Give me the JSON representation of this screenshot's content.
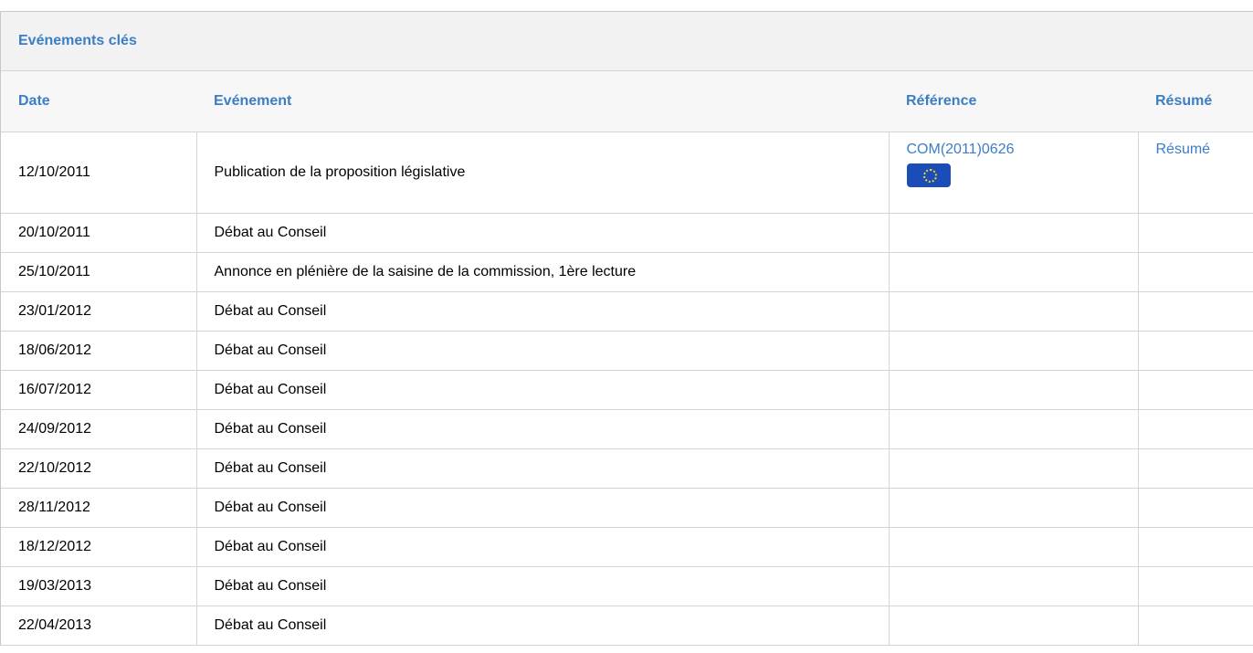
{
  "panel": {
    "title": "Evénements clés"
  },
  "table": {
    "headers": {
      "date": "Date",
      "event": "Evénement",
      "reference": "Référence",
      "summary": "Résumé"
    },
    "rows": [
      {
        "date": "12/10/2011",
        "event": "Publication de la proposition législative",
        "reference": "COM(2011)0626",
        "reference_icon": "eu-flag-icon",
        "summary": "Résumé"
      },
      {
        "date": "20/10/2011",
        "event": "Débat au Conseil",
        "reference": "",
        "summary": ""
      },
      {
        "date": "25/10/2011",
        "event": "Annonce en plénière de la saisine de la commission, 1ère lecture",
        "reference": "",
        "summary": ""
      },
      {
        "date": "23/01/2012",
        "event": "Débat au Conseil",
        "reference": "",
        "summary": ""
      },
      {
        "date": "18/06/2012",
        "event": "Débat au Conseil",
        "reference": "",
        "summary": ""
      },
      {
        "date": "16/07/2012",
        "event": "Débat au Conseil",
        "reference": "",
        "summary": ""
      },
      {
        "date": "24/09/2012",
        "event": "Débat au Conseil",
        "reference": "",
        "summary": ""
      },
      {
        "date": "22/10/2012",
        "event": "Débat au Conseil",
        "reference": "",
        "summary": ""
      },
      {
        "date": "28/11/2012",
        "event": "Débat au Conseil",
        "reference": "",
        "summary": ""
      },
      {
        "date": "18/12/2012",
        "event": "Débat au Conseil",
        "reference": "",
        "summary": ""
      },
      {
        "date": "19/03/2013",
        "event": "Débat au Conseil",
        "reference": "",
        "summary": ""
      },
      {
        "date": "22/04/2013",
        "event": "Débat au Conseil",
        "reference": "",
        "summary": ""
      }
    ]
  },
  "colors": {
    "accent": "#3c7ec6",
    "header_bg": "#f2f2f2",
    "border": "#d4d4d4",
    "flag_blue": "#1b4db8",
    "flag_star": "#f3d125"
  }
}
